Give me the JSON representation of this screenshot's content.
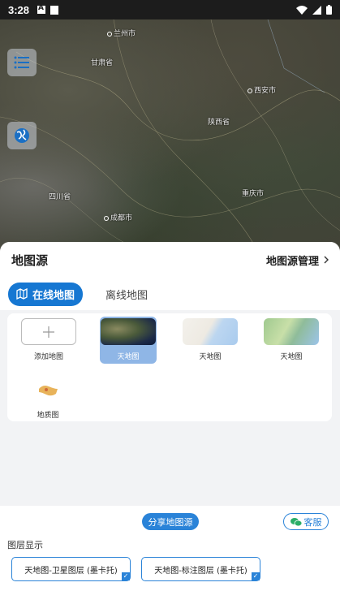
{
  "status_bar": {
    "time": "3:28",
    "wifi_icon": "wifi-icon",
    "signal_icon": "signal-icon",
    "battery_icon": "battery-icon"
  },
  "map": {
    "cities": [
      {
        "name": "兰州市"
      },
      {
        "name": "甘肃省"
      },
      {
        "name": "西安市"
      },
      {
        "name": "陕西省"
      },
      {
        "name": "四川省"
      },
      {
        "name": "重庆市"
      },
      {
        "name": "成都市"
      }
    ],
    "menu_icon": "list-icon",
    "globe_icon": "globe-icon"
  },
  "sheet": {
    "title": "地图源",
    "manage_label": "地图源管理",
    "tabs": [
      {
        "label": "在线地图",
        "active": true
      },
      {
        "label": "离线地图",
        "active": false
      }
    ],
    "tiles": [
      {
        "label": "添加地图",
        "kind": "add"
      },
      {
        "label": "天地图",
        "kind": "satellite",
        "selected": true
      },
      {
        "label": "天地图",
        "kind": "vector"
      },
      {
        "label": "天地图",
        "kind": "terrain"
      },
      {
        "label": "地质图",
        "kind": "geology"
      }
    ]
  },
  "bottom": {
    "share_label": "分享地图源",
    "service_label": "客服",
    "layer_title": "图层显示",
    "layers": [
      {
        "label": "天地图-卫星图层 (墨卡托)",
        "checked": true
      },
      {
        "label": "天地图-标注图层 (墨卡托)",
        "checked": true
      }
    ]
  },
  "colors": {
    "accent": "#1677d2",
    "selected_tile": "#8fb6e6",
    "sheet_bg": "#f2f3f5"
  }
}
